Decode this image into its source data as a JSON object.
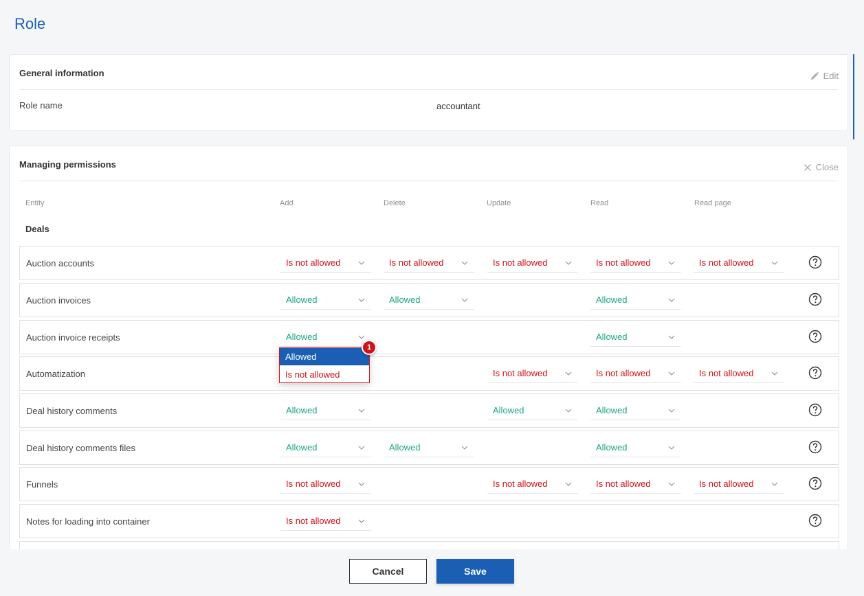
{
  "page": {
    "title": "Role"
  },
  "general": {
    "title": "General information",
    "edit_label": "Edit",
    "role_name_label": "Role name",
    "role_name_value": "accountant"
  },
  "permissions": {
    "title": "Managing permissions",
    "close_label": "Close",
    "columns": [
      "Entity",
      "Add",
      "Delete",
      "Update",
      "Read",
      "Read page"
    ],
    "group": "Deals",
    "rows": [
      {
        "entity": "Auction accounts",
        "add": "Is not allowed",
        "delete": "Is not allowed",
        "update": "Is not allowed",
        "read": "Is not allowed",
        "read_page": "Is not allowed"
      },
      {
        "entity": "Auction invoices",
        "add": "Allowed",
        "delete": "Allowed",
        "update": null,
        "read": "Allowed",
        "read_page": null
      },
      {
        "entity": "Auction invoice receipts",
        "add": "Allowed",
        "delete": null,
        "update": null,
        "read": "Allowed",
        "read_page": null
      },
      {
        "entity": "Automatization",
        "add": null,
        "delete": null,
        "update": "Is not allowed",
        "read": "Is not allowed",
        "read_page": "Is not allowed"
      },
      {
        "entity": "Deal history comments",
        "add": "Allowed",
        "delete": null,
        "update": "Allowed",
        "read": "Allowed",
        "read_page": null
      },
      {
        "entity": "Deal history comments files",
        "add": "Allowed",
        "delete": "Allowed",
        "update": null,
        "read": "Allowed",
        "read_page": null
      },
      {
        "entity": "Funnels",
        "add": "Is not allowed",
        "delete": null,
        "update": "Is not allowed",
        "read": "Is not allowed",
        "read_page": "Is not allowed"
      },
      {
        "entity": "Notes for loading into container",
        "add": "Is not allowed",
        "delete": null,
        "update": null,
        "read": null,
        "read_page": null
      }
    ]
  },
  "dropdown": {
    "options": [
      "Allowed",
      "Is not allowed"
    ],
    "selected": "Allowed",
    "badge": "1"
  },
  "footer": {
    "cancel_label": "Cancel",
    "save_label": "Save"
  },
  "colors": {
    "accent": "#1a5fb4",
    "allowed": "#1aa582",
    "not_allowed": "#d0121b"
  }
}
